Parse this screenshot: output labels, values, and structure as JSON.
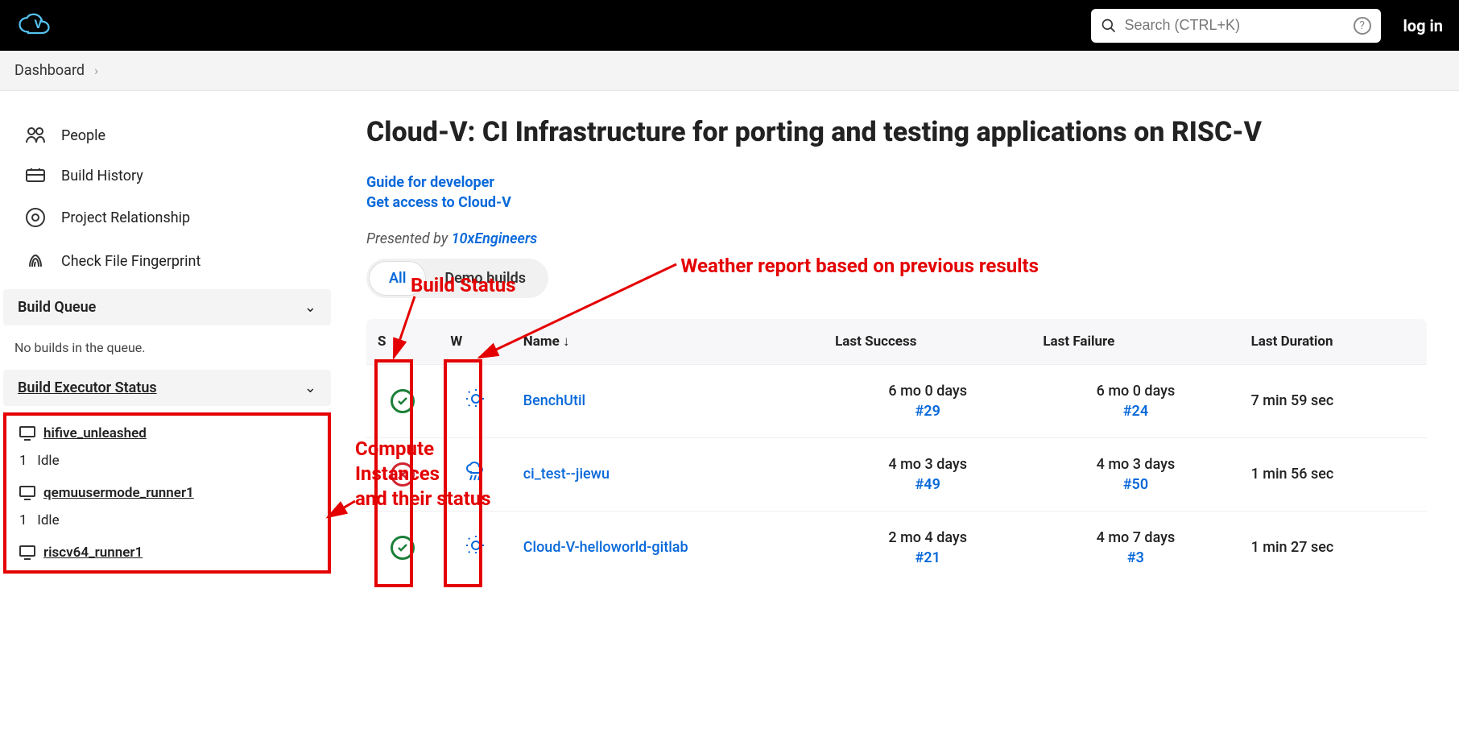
{
  "header": {
    "logo_text": "Cloud",
    "search_placeholder": "Search (CTRL+K)",
    "login": "log in"
  },
  "breadcrumb": {
    "item": "Dashboard"
  },
  "sidebar": {
    "nav": [
      {
        "label": "People",
        "icon": "people-icon"
      },
      {
        "label": "Build History",
        "icon": "history-icon"
      },
      {
        "label": "Project Relationship",
        "icon": "relationship-icon"
      },
      {
        "label": "Check File Fingerprint",
        "icon": "fingerprint-icon"
      }
    ],
    "build_queue_title": "Build Queue",
    "build_queue_empty": "No builds in the queue.",
    "executor_title": "Build Executor Status",
    "executors": [
      {
        "name": "hifive_unleashed",
        "slot_num": "1",
        "slot_state": "Idle"
      },
      {
        "name": "qemuusermode_runner1",
        "slot_num": "1",
        "slot_state": "Idle"
      },
      {
        "name": "riscv64_runner1"
      }
    ]
  },
  "main": {
    "title": "Cloud-V: CI Infrastructure for porting and testing applications on RISC-V",
    "links": {
      "guide": "Guide for developer",
      "access": "Get access to Cloud-V"
    },
    "presented_prefix": "Presented by ",
    "presented_link": "10xEngineers",
    "tabs": {
      "all": "All",
      "demo": "Demo builds"
    },
    "columns": {
      "s": "S",
      "w": "W",
      "name": "Name ↓",
      "ls": "Last Success",
      "lf": "Last Failure",
      "ld": "Last Duration"
    },
    "jobs": [
      {
        "status": "green",
        "weather": "sun",
        "name": "BenchUtil",
        "ls_time": "6 mo 0 days",
        "ls_run": "#29",
        "lf_time": "6 mo 0 days",
        "lf_run": "#24",
        "duration": "7 min 59 sec"
      },
      {
        "status": "red",
        "weather": "rain",
        "name": "ci_test--jiewu",
        "ls_time": "4 mo 3 days",
        "ls_run": "#49",
        "lf_time": "4 mo 3 days",
        "lf_run": "#50",
        "duration": "1 min 56 sec"
      },
      {
        "status": "green",
        "weather": "sun",
        "name": "Cloud-V-helloworld-gitlab",
        "ls_time": "2 mo 4 days",
        "ls_run": "#21",
        "lf_time": "4 mo 7 days",
        "lf_run": "#3",
        "duration": "1 min 27 sec"
      }
    ]
  },
  "annotations": {
    "build_status": "Build Status",
    "weather": "Weather report based on previous results",
    "compute": "Compute Instances and their status"
  }
}
